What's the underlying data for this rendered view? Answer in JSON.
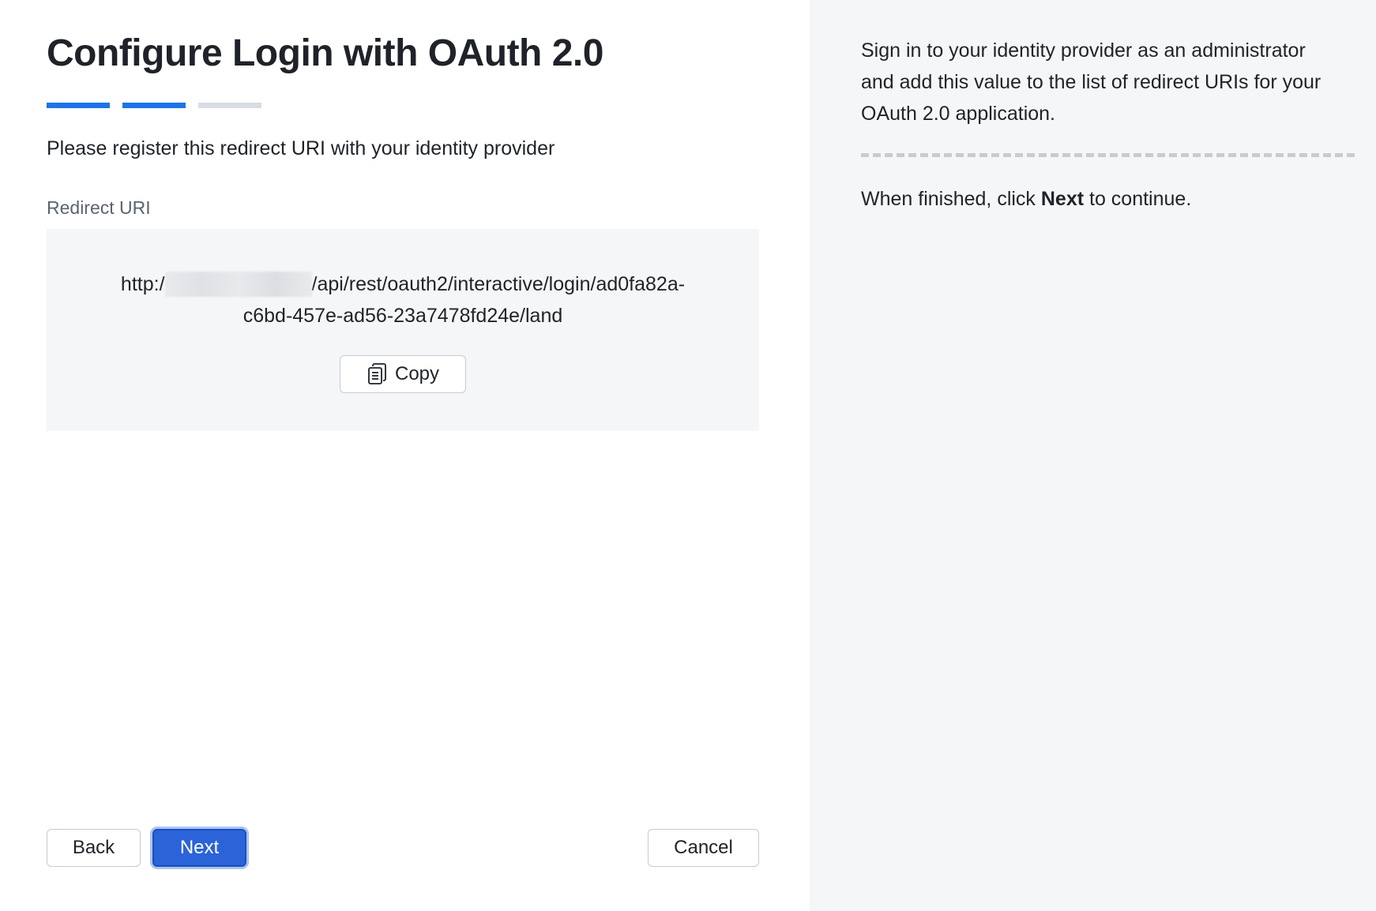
{
  "dialog": {
    "title": "Configure Login with OAuth 2.0",
    "steps": [
      {
        "state": "complete"
      },
      {
        "state": "current"
      },
      {
        "state": "pending"
      }
    ]
  },
  "main": {
    "instruction": "Please register this redirect URI with your identity provider",
    "field_label": "Redirect URI",
    "uri_prefix": "http:/",
    "uri_suffix_line1": "/api/rest/oauth2/interactive/login/ad0fa82a-",
    "uri_line2": "c6bd-457e-ad56-23a7478fd24e/land",
    "copy_label": "Copy",
    "copy_icon": "copy-icon"
  },
  "footer": {
    "back_label": "Back",
    "next_label": "Next",
    "cancel_label": "Cancel"
  },
  "sidebar": {
    "help_text": "Sign in to your identity provider as an administrator and add this value to the list of redirect URIs for your OAuth 2.0 application.",
    "finish_before": "When finished, click ",
    "finish_bold": "Next",
    "finish_after": " to continue."
  },
  "colors": {
    "accent": "#1f73e8",
    "primary_button": "#2b63d9",
    "panel_bg": "#f5f6f8"
  }
}
